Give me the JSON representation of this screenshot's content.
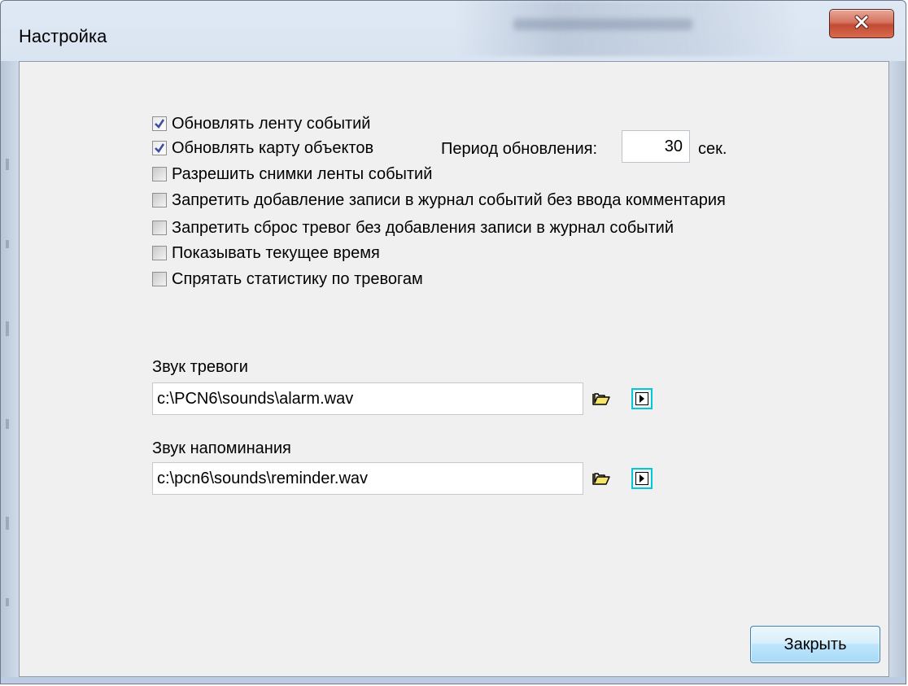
{
  "window": {
    "title": "Настройка"
  },
  "options": [
    {
      "label": "Обновлять ленту событий",
      "checked": true
    },
    {
      "label": "Обновлять карту объектов",
      "checked": true
    },
    {
      "label": "Разрешить снимки ленты событий",
      "checked": false
    },
    {
      "label": "Запретить добавление записи в журнал событий без ввода комментария",
      "checked": false
    },
    {
      "label": "Запретить сброс тревог без добавления записи в журнал событий",
      "checked": false
    },
    {
      "label": "Показывать текущее время",
      "checked": false
    },
    {
      "label": "Спрятать статистику по тревогам",
      "checked": false
    }
  ],
  "period": {
    "label": "Период обновления:",
    "value": "30",
    "unit": "сек."
  },
  "alarm_sound": {
    "label": "Звук тревоги",
    "path": "c:\\PCN6\\sounds\\alarm.wav"
  },
  "reminder_sound": {
    "label": "Звук напоминания",
    "path": "c:\\pcn6\\sounds\\reminder.wav"
  },
  "buttons": {
    "close_label": "Закрыть"
  },
  "icons": {
    "close": "close-icon",
    "folder": "folder-open-icon",
    "play": "play-icon"
  }
}
